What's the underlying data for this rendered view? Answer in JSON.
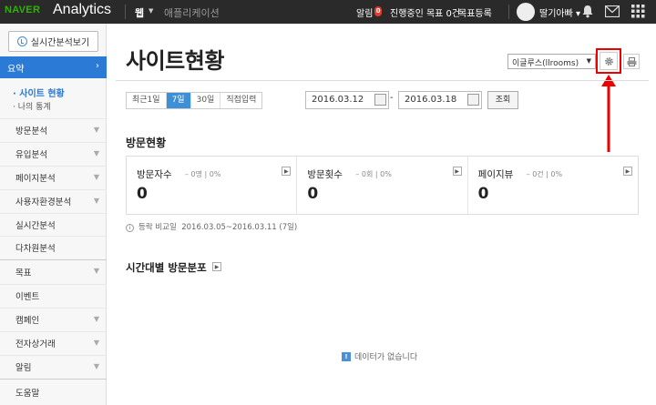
{
  "topbar": {
    "brand": "NAVER",
    "product": "Analytics",
    "nav_web": "웹",
    "nav_app": "애플리케이션",
    "alarm_label": "알림",
    "alarm_count": "0",
    "goals_label": "진행중인 목표 0건",
    "goal_register": "목표등록",
    "user_name": "딸기아빠"
  },
  "sidebar": {
    "realtime_button": "실시간분석보기",
    "active_menu": "요약",
    "sub_items": [
      "· 사이트 현황",
      "· 나의 통계"
    ],
    "menu_items": [
      "방문분석",
      "유입분석",
      "페이지분석",
      "사용자환경분석",
      "실시간분석",
      "다차원분석",
      "목표",
      "이벤트",
      "캠페인",
      "전자상거래",
      "알림",
      "도움말"
    ]
  },
  "main": {
    "page_title": "사이트현황",
    "site_selector": "이글루스(llrooms)",
    "period_buttons": [
      "최근1일",
      "7일",
      "30일",
      "직접입력"
    ],
    "date_start": "2016.03.12",
    "date_end": "2016.03.18",
    "search_button": "조회",
    "visit_section_title": "방문현황",
    "stats": [
      {
        "label": "방문자수",
        "delta": "– 0명 | 0%",
        "value": "0"
      },
      {
        "label": "방문횟수",
        "delta": "– 0회 | 0%",
        "value": "0"
      },
      {
        "label": "페이지뷰",
        "delta": "– 0건 | 0%",
        "value": "0"
      }
    ],
    "compare_label": "등락 비교일",
    "compare_range": "2016.03.05~2016.03.11 (7일)",
    "hourly_section_title": "시간대별 방문분포",
    "empty_message": "데이터가 없습니다"
  },
  "colors": {
    "topbar_bg": "#2a2a2a",
    "brand_green": "#2db400",
    "accent_blue": "#2b7ad6",
    "highlight_red": "#e00000"
  }
}
